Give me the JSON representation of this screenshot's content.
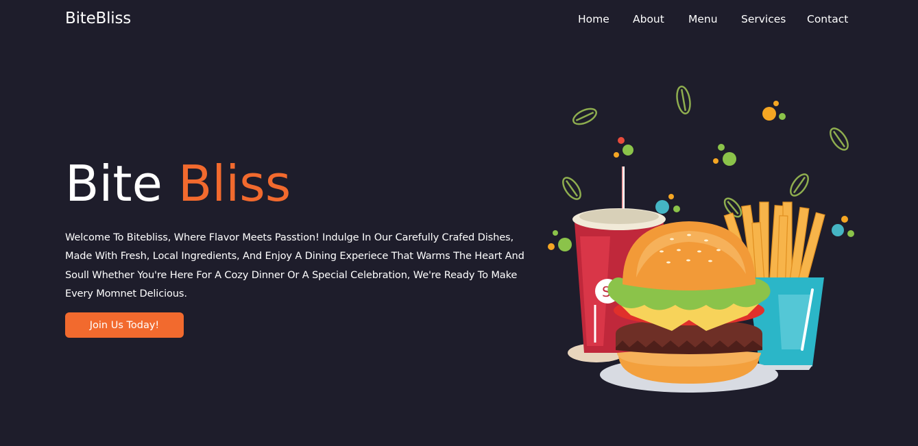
{
  "header": {
    "brand": "BiteBliss",
    "nav": [
      "Home",
      "About",
      "Menu",
      "Services",
      "Contact"
    ]
  },
  "hero": {
    "title_part1": "Bite",
    "title_part2": "Bliss",
    "description": "Welcome To Bitebliss, Where Flavor Meets Passtion! Indulge In Our Carefully Crafed Dishes, Made With Fresh, Local Ingredients, And Enjoy A Dining Experiece That Warms The Heart And Soull Whether You're Here For A Cozy Dinner Or A Special Celebration, We're Ready To Make Every Momnet Delicious.",
    "cta_label": "Join Us Today!"
  },
  "colors": {
    "background": "#1e1d2b",
    "accent": "#f26a2e",
    "text": "#ffffff"
  },
  "illustration": {
    "icons": [
      "soda-cup-icon",
      "burger-icon",
      "fries-icon",
      "leaf-icon",
      "dot-decoration"
    ]
  }
}
